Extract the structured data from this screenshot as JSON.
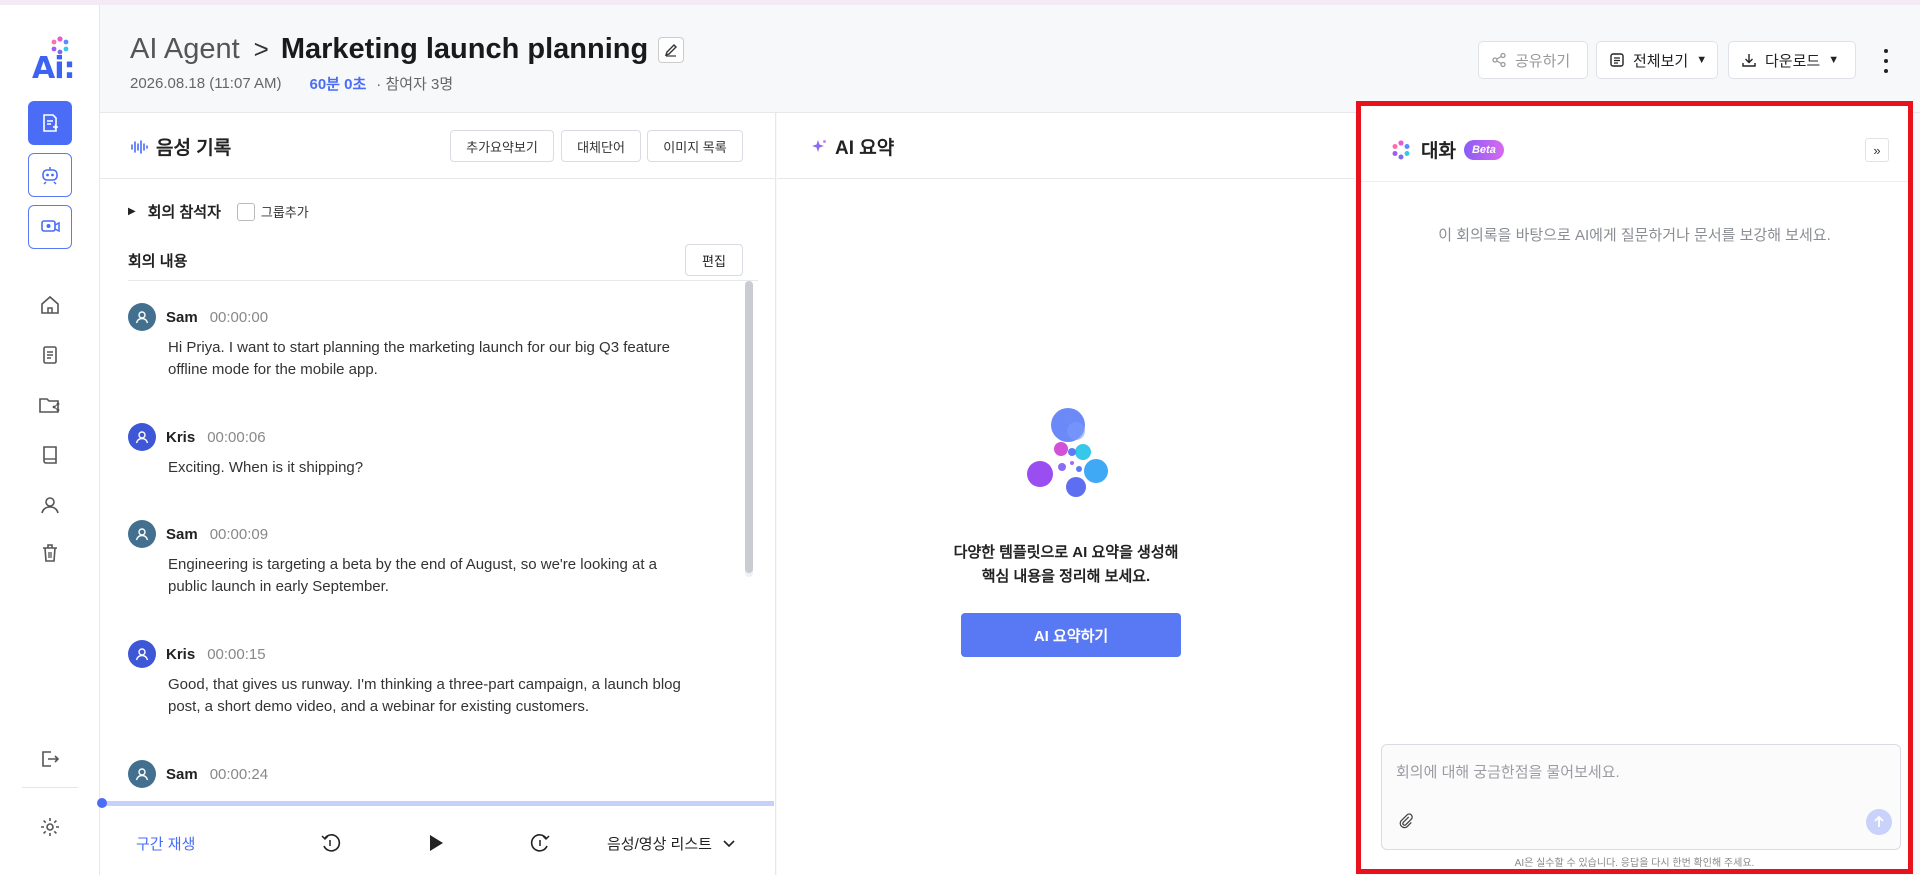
{
  "app": {
    "logo_text": "Ai:",
    "colors": {
      "accent": "#4a6cf7",
      "highlight_border": "#e8121d"
    }
  },
  "rail": {
    "items": [
      {
        "icon": "new-note-icon"
      },
      {
        "icon": "ai-bot-icon"
      },
      {
        "icon": "video-record-icon"
      },
      {
        "icon": "home-icon"
      },
      {
        "icon": "document-list-icon"
      },
      {
        "icon": "shared-folder-icon"
      },
      {
        "icon": "book-icon"
      },
      {
        "icon": "user-icon"
      },
      {
        "icon": "trash-icon"
      },
      {
        "icon": "logout-icon"
      },
      {
        "icon": "settings-icon"
      }
    ]
  },
  "header": {
    "breadcrumb_root": "AI Agent",
    "breadcrumb_sep": ">",
    "title": "Marketing launch planning",
    "date": "2026.08.18 (11:07 AM)",
    "duration": "60분 0초",
    "participants": "· 참여자 3명",
    "share_label": "공유하기",
    "view_label": "전체보기",
    "download_label": "다운로드"
  },
  "voice": {
    "title": "음성 기록",
    "btn_more_summary": "추가요약보기",
    "btn_substitute": "대체단어",
    "btn_images": "이미지 목록",
    "participants_label": "회의 참석자",
    "group_add": "그룹추가",
    "content_label": "회의 내용",
    "edit_label": "편집",
    "messages": [
      {
        "speaker": "Sam",
        "time": "00:00:00",
        "text": "Hi Priya. I want to start planning the marketing launch for our big Q3 feature offline mode for the mobile app."
      },
      {
        "speaker": "Kris",
        "time": "00:00:06",
        "text": "Exciting. When is it shipping?"
      },
      {
        "speaker": "Sam",
        "time": "00:00:09",
        "text": "Engineering is targeting a beta by the end of August, so we're looking at a public launch in early September."
      },
      {
        "speaker": "Kris",
        "time": "00:00:15",
        "text": "Good, that gives us runway.  I'm thinking a three-part campaign, a launch blog post, a short demo video, and a webinar  for existing customers."
      },
      {
        "speaker": "Sam",
        "time": "00:00:24",
        "text": ""
      }
    ],
    "segment_play": "구간 재생",
    "media_list": "음성/영상 리스트",
    "progress": 0.0
  },
  "summary": {
    "title": "AI 요약",
    "message_line1": "다양한 템플릿으로 AI 요약을 생성해",
    "message_line2": "핵심 내용을 정리해 보세요.",
    "button": "AI 요약하기"
  },
  "chat": {
    "title": "대화",
    "badge": "Beta",
    "collapse": "»",
    "hint": "이 회의록을 바탕으로 AI에게 질문하거나 문서를 보강해 보세요.",
    "input_placeholder": "회의에 대해 궁금한점을 물어보세요.",
    "disclaimer": "AI은 실수할 수 있습니다. 응답을 다시 한번 확인해 주세요."
  }
}
